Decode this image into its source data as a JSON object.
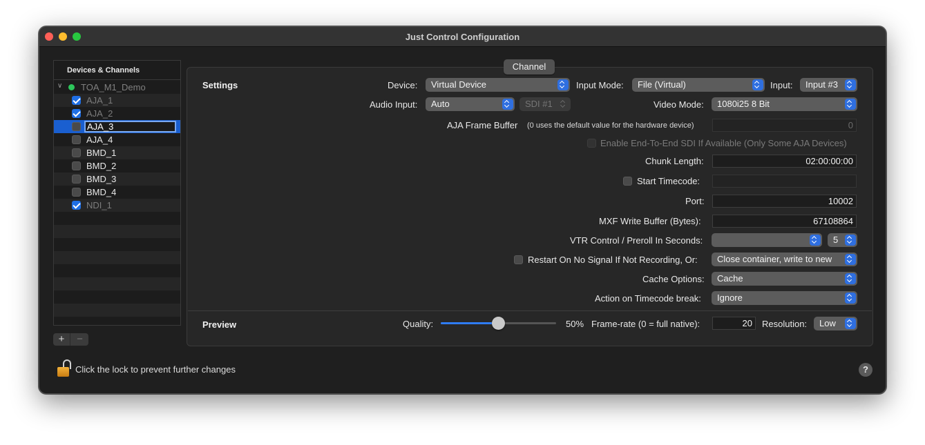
{
  "window": {
    "title": "Just Control Configuration"
  },
  "sidebar": {
    "header": "Devices & Channels",
    "group": {
      "label": "TOA_M1_Demo",
      "status_color": "#2dc65b"
    },
    "items": [
      {
        "label": "AJA_1",
        "checked": true,
        "dim": true
      },
      {
        "label": "AJA_2",
        "checked": true,
        "dim": true
      },
      {
        "label": "AJA_3",
        "checked": false,
        "editing": true
      },
      {
        "label": "AJA_4",
        "checked": false
      },
      {
        "label": "BMD_1",
        "checked": false
      },
      {
        "label": "BMD_2",
        "checked": false
      },
      {
        "label": "BMD_3",
        "checked": false
      },
      {
        "label": "BMD_4",
        "checked": false
      },
      {
        "label": "NDI_1",
        "checked": true,
        "dim": true
      }
    ],
    "add_label": "+",
    "remove_label": "−"
  },
  "tab": {
    "label": "Channel"
  },
  "settings": {
    "title": "Settings",
    "device_label": "Device:",
    "device_value": "Virtual Device",
    "input_mode_label": "Input Mode:",
    "input_mode_value": "File (Virtual)",
    "input_label": "Input:",
    "input_value": "Input #3",
    "audio_input_label": "Audio Input:",
    "audio_input_value": "Auto",
    "sdi_value": "SDI #1",
    "video_mode_label": "Video Mode:",
    "video_mode_value": "1080i25 8 Bit",
    "frame_buffer_label": "AJA Frame Buffer",
    "frame_buffer_hint": "(0 uses the default value for the hardware device)",
    "frame_buffer_value": "0",
    "e2e_label": "Enable End-To-End SDI If Available (Only Some AJA Devices)",
    "chunk_length_label": "Chunk Length:",
    "chunk_length_value": "02:00:00:00",
    "start_tc_label": "Start Timecode:",
    "start_tc_value": "",
    "port_label": "Port:",
    "port_value": "10002",
    "mxf_label": "MXF Write Buffer (Bytes):",
    "mxf_value": "67108864",
    "vtr_label": "VTR Control / Preroll In Seconds:",
    "vtr_value": "",
    "preroll_value": "5",
    "restart_label": "Restart On No Signal If Not Recording, Or:",
    "restart_value": "Close container, write to new",
    "cache_label": "Cache Options:",
    "cache_value": "Cache",
    "tc_break_label": "Action on Timecode break:",
    "tc_break_value": "Ignore"
  },
  "preview": {
    "title": "Preview",
    "quality_label": "Quality:",
    "quality_percent": 50,
    "quality_text": "50%",
    "framerate_label": "Frame-rate (0 = full native):",
    "framerate_value": "20",
    "resolution_label": "Resolution:",
    "resolution_value": "Low"
  },
  "footer": {
    "lock_text": "Click the lock to prevent further changes",
    "help_label": "?"
  },
  "colors": {
    "accent": "#2f6fe0",
    "selection": "#1a5fd0"
  }
}
